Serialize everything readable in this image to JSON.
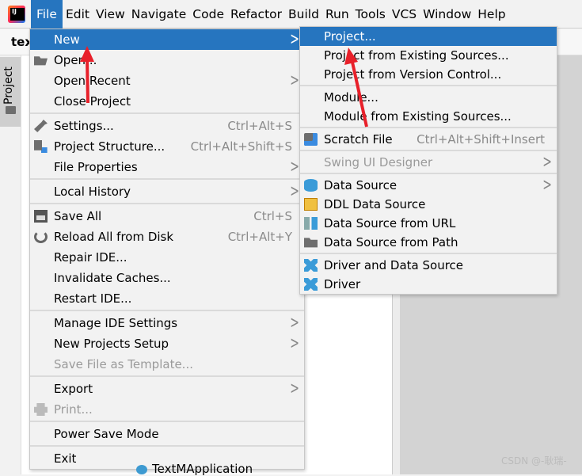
{
  "menubar": [
    {
      "label": "File",
      "m": "F",
      "active": true
    },
    {
      "label": "Edit",
      "m": "E"
    },
    {
      "label": "View",
      "m": "V"
    },
    {
      "label": "Navigate",
      "m": "N"
    },
    {
      "label": "Code",
      "m": "C"
    },
    {
      "label": "Refactor",
      "m": "R"
    },
    {
      "label": "Build",
      "m": "B"
    },
    {
      "label": "Run",
      "m": "u"
    },
    {
      "label": "Tools",
      "m": "T"
    },
    {
      "label": "VCS",
      "m": ""
    },
    {
      "label": "Window",
      "m": "W"
    },
    {
      "label": "Help",
      "m": "H"
    }
  ],
  "toolbar": {
    "project_name": "tex"
  },
  "sidebar": {
    "project_tab": "Project"
  },
  "tree": {
    "item": "TextMApplication"
  },
  "file_menu": [
    {
      "label": "New",
      "m": "N",
      "arrow": true,
      "sel": true
    },
    {
      "label": "Open...",
      "m": "O",
      "icon": "folder-open-icon"
    },
    {
      "label": "Open Recent",
      "m": "R",
      "arrow": true
    },
    {
      "label": "Close Project",
      "m": ""
    },
    {
      "sep": true
    },
    {
      "label": "Settings...",
      "m": "t",
      "icon": "wrench-icon",
      "shortcut": "Ctrl+Alt+S"
    },
    {
      "label": "Project Structure...",
      "m": "",
      "icon": "project-structure-icon",
      "shortcut": "Ctrl+Alt+Shift+S"
    },
    {
      "label": "File Properties",
      "m": "",
      "arrow": true
    },
    {
      "sep": true
    },
    {
      "label": "Local History",
      "m": "H",
      "arrow": true
    },
    {
      "sep": true
    },
    {
      "label": "Save All",
      "m": "S",
      "icon": "save-icon",
      "shortcut": "Ctrl+S"
    },
    {
      "label": "Reload All from Disk",
      "m": "",
      "icon": "reload-icon",
      "shortcut": "Ctrl+Alt+Y"
    },
    {
      "label": "Repair IDE...",
      "m": ""
    },
    {
      "label": "Invalidate Caches...",
      "m": ""
    },
    {
      "label": "Restart IDE...",
      "m": ""
    },
    {
      "sep": true
    },
    {
      "label": "Manage IDE Settings",
      "m": "",
      "arrow": true
    },
    {
      "label": "New Projects Setup",
      "m": "",
      "arrow": true
    },
    {
      "label": "Save File as Template...",
      "m": "l",
      "disabled": true
    },
    {
      "sep": true
    },
    {
      "label": "Export",
      "m": "",
      "arrow": true
    },
    {
      "label": "Print...",
      "m": "P",
      "icon": "print-icon",
      "disabled": true
    },
    {
      "sep": true
    },
    {
      "label": "Power Save Mode",
      "m": ""
    },
    {
      "sep": true
    },
    {
      "label": "Exit",
      "m": "x"
    }
  ],
  "new_submenu": [
    {
      "label": "Project...",
      "sel": true
    },
    {
      "label": "Project from Existing Sources..."
    },
    {
      "label": "Project from Version Control..."
    },
    {
      "sep": true
    },
    {
      "label": "Module..."
    },
    {
      "label": "Module from Existing Sources..."
    },
    {
      "sep": true
    },
    {
      "label": "Scratch File",
      "icon": "scratch-file-icon",
      "shortcut": "Ctrl+Alt+Shift+Insert"
    },
    {
      "sep": true
    },
    {
      "label": "Swing UI Designer",
      "disabled": true,
      "arrow": true
    },
    {
      "sep": true
    },
    {
      "label": "Data Source",
      "icon": "database-icon",
      "arrow": true
    },
    {
      "label": "DDL Data Source",
      "icon": "ddl-icon"
    },
    {
      "label": "Data Source from URL",
      "icon": "url-icon"
    },
    {
      "label": "Data Source from Path",
      "icon": "folder-icon"
    },
    {
      "sep": true
    },
    {
      "label": "Driver and Data Source",
      "icon": "driver-icon"
    },
    {
      "label": "Driver",
      "icon": "driver-icon"
    }
  ],
  "watermark": "CSDN @-耿瑞-",
  "colors": {
    "highlight": "#2675bf",
    "arrow": "#e8202a"
  }
}
